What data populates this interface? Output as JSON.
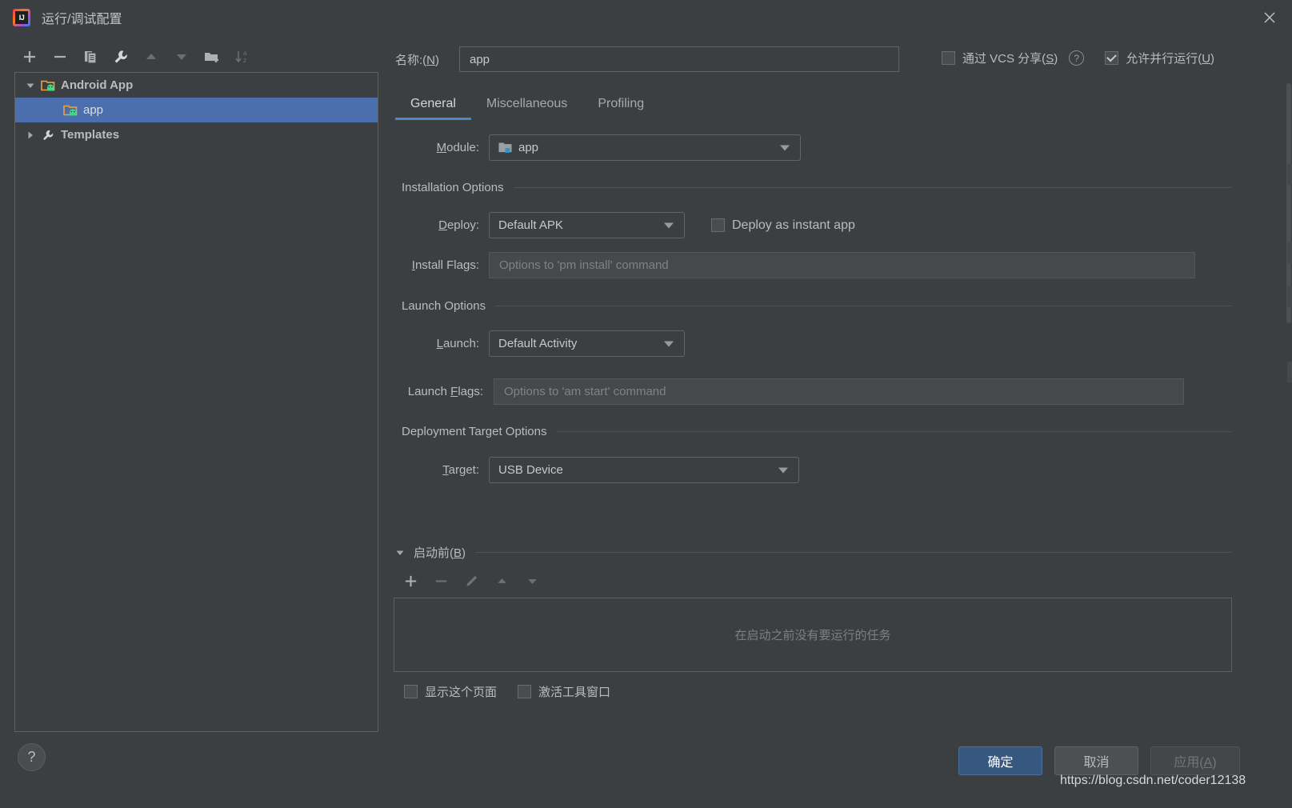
{
  "window": {
    "title": "运行/调试配置",
    "logo_icon": "intellij-idea-logo",
    "close_icon": "close-icon"
  },
  "left_panel": {
    "toolbar": [
      {
        "name": "add",
        "icon": "plus-icon",
        "enabled": true
      },
      {
        "name": "remove",
        "icon": "minus-icon",
        "enabled": true
      },
      {
        "name": "copy",
        "icon": "copy-icon",
        "enabled": true
      },
      {
        "name": "edit-templates",
        "icon": "wrench-icon",
        "enabled": true
      },
      {
        "name": "move-up",
        "icon": "arrow-up-icon",
        "enabled": false
      },
      {
        "name": "move-down",
        "icon": "arrow-down-icon",
        "enabled": false
      },
      {
        "name": "new-folder",
        "icon": "folder-add-icon",
        "enabled": true
      },
      {
        "name": "sort-alphabetically",
        "icon": "sort-az-icon",
        "enabled": false
      }
    ],
    "tree": [
      {
        "label": "Android App",
        "icon": "android-folder-icon",
        "twisty": "expanded",
        "level": 0,
        "selected": false,
        "bold": true
      },
      {
        "label": "app",
        "icon": "android-folder-icon",
        "twisty": "none",
        "level": 1,
        "selected": true,
        "bold": false
      },
      {
        "label": "Templates",
        "icon": "wrench-icon",
        "twisty": "collapsed",
        "level": 0,
        "selected": false,
        "bold": true
      }
    ],
    "help_button": {
      "label": "?",
      "icon": "question-mark-icon"
    }
  },
  "header": {
    "name_label": "名称:(N)",
    "name_label_plain": "名称:(",
    "name_label_mnemonic": "N",
    "name_label_tail": ")",
    "name_value": "app",
    "share_vcs": {
      "label_pre": "通过 VCS 分享(",
      "mnemonic": "S",
      "label_post": ")",
      "checked": false
    },
    "help_icon": "question-mark-circle-icon",
    "allow_parallel": {
      "label_pre": "允许并行运行(",
      "mnemonic": "U",
      "label_post": ")",
      "checked": true
    }
  },
  "tabs": [
    {
      "label": "General",
      "active": true
    },
    {
      "label": "Miscellaneous",
      "active": false
    },
    {
      "label": "Profiling",
      "active": false
    }
  ],
  "general": {
    "module": {
      "label_pre": "",
      "mnemonic": "M",
      "label_post": "odule:",
      "value": "app",
      "icon": "module-icon",
      "dropdown_icon": "chevron-down-icon"
    },
    "installation_group": "Installation Options",
    "deploy": {
      "mnemonic": "D",
      "label_post": "eploy:",
      "value": "Default APK",
      "dropdown_icon": "chevron-down-icon"
    },
    "deploy_instant": {
      "label": "Deploy as instant app",
      "checked": false
    },
    "install_flags": {
      "mnemonic": "I",
      "label_post": "nstall Flags:",
      "value": "",
      "placeholder": "Options to 'pm install' command"
    },
    "launch_group": "Launch Options",
    "launch": {
      "mnemonic": "L",
      "label_post": "aunch:",
      "value": "Default Activity",
      "dropdown_icon": "chevron-down-icon"
    },
    "launch_flags": {
      "label_pre": "Launch ",
      "mnemonic": "F",
      "label_post": "lags:",
      "value": "",
      "placeholder": "Options to 'am start' command"
    },
    "deployment_group": "Deployment Target Options",
    "target": {
      "mnemonic": "T",
      "label_post": "arget:",
      "value": "USB Device",
      "dropdown_icon": "chevron-down-icon"
    }
  },
  "before_launch": {
    "title_pre": "启动前(",
    "mnemonic": "B",
    "title_post": ")",
    "twisty": "expanded",
    "toolbar": [
      {
        "name": "add-task",
        "icon": "plus-icon",
        "enabled": true
      },
      {
        "name": "remove-task",
        "icon": "minus-icon",
        "enabled": false
      },
      {
        "name": "edit-task",
        "icon": "pencil-icon",
        "enabled": false
      },
      {
        "name": "move-task-up",
        "icon": "arrow-up-icon",
        "enabled": false
      },
      {
        "name": "move-task-down",
        "icon": "arrow-down-icon",
        "enabled": false
      }
    ],
    "empty_text": "在启动之前没有要运行的任务",
    "show_page": {
      "label": "显示这个页面",
      "checked": false
    },
    "activate_tool_window": {
      "label": "激活工具窗口",
      "checked": false
    }
  },
  "footer": {
    "ok": {
      "label": "确定",
      "style": "primary"
    },
    "cancel": {
      "label": "取消",
      "style": "default"
    },
    "apply": {
      "label_pre": "应用(",
      "mnemonic": "A",
      "label_post": ")",
      "style": "disabled"
    }
  },
  "watermark": "https://blog.csdn.net/coder12138",
  "colors": {
    "background": "#3c3f41",
    "selection": "#4b6eaf",
    "accent": "#4a88c7",
    "primary_button": "#365880",
    "text": "#bbbbbb",
    "placeholder": "#7e8385",
    "border": "#5e6060"
  }
}
